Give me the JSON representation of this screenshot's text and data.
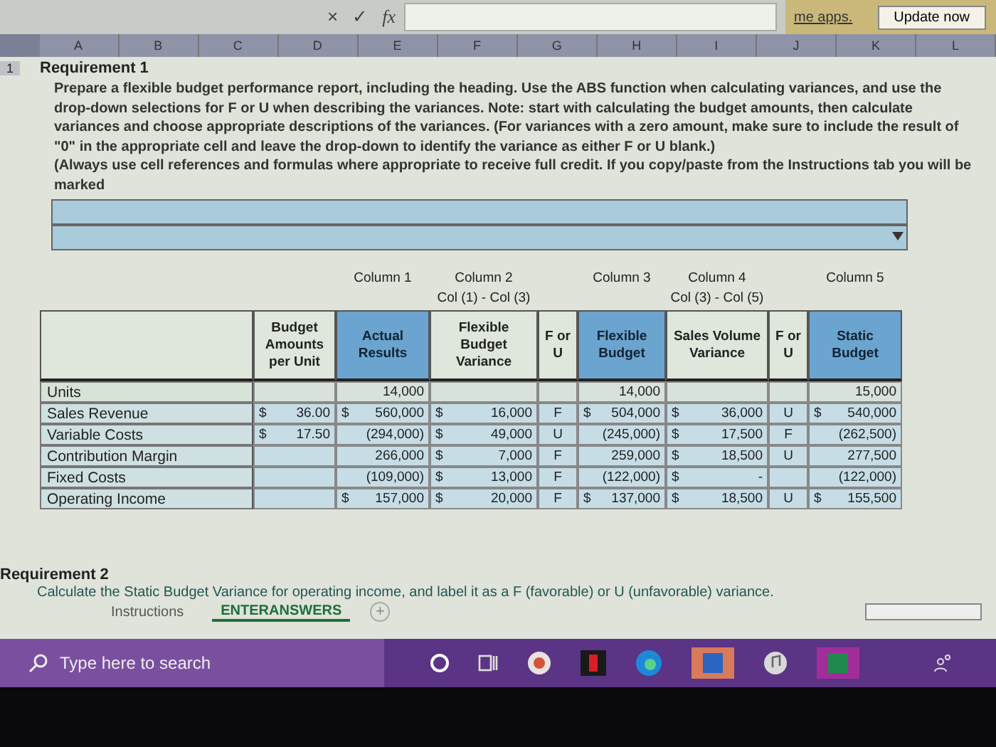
{
  "formula_bar": {
    "cancel": "×",
    "enter": "✓",
    "function": "fx"
  },
  "notice": {
    "text": "me apps.",
    "button": "Update now"
  },
  "column_headers": [
    "A",
    "B",
    "C",
    "D",
    "E",
    "F",
    "G",
    "H",
    "I",
    "J",
    "K",
    "L"
  ],
  "requirement_1": {
    "row_number": "1",
    "title": "Requirement 1",
    "instructions": [
      "Prepare a flexible budget performance report, including the heading. Use the ABS function when calculating variances, and use the drop-down selections for F or U when describing the variances. Note: start with calculating the budget amounts, then calculate variances and choose appropriate descriptions of the variances. (For variances with a zero amount, make sure to include the result of \"0\" in the appropriate cell and leave the drop-down to identify the variance as either F or U blank.)",
      "(Always use cell references and formulas where appropriate to receive full credit. If you copy/paste from the Instructions tab you will be marked"
    ]
  },
  "report": {
    "columns": [
      {
        "label": "Budget Amounts per Unit",
        "highlighted": false
      },
      {
        "group": {
          "title": "Column 1"
        },
        "label": "Actual Results",
        "highlighted": true
      },
      {
        "group": {
          "title": "Column 2",
          "subtitle": "Col (1) - Col (3)"
        },
        "label": "Flexible Budget Variance",
        "highlighted": false
      },
      {
        "label": "F or U",
        "highlighted": false
      },
      {
        "group": {
          "title": "Column 3"
        },
        "label": "Flexible Budget",
        "highlighted": true
      },
      {
        "group": {
          "title": "Column 4",
          "subtitle": "Col (3) - Col (5)"
        },
        "label": "Sales Volume Variance",
        "highlighted": false
      },
      {
        "label": "F or U",
        "highlighted": false
      },
      {
        "group": {
          "title": "Column 5"
        },
        "label": "Static Budget",
        "highlighted": true
      }
    ],
    "rows": [
      {
        "label": "Units",
        "cells": [
          {},
          {
            "value": "14,000"
          },
          {},
          {},
          {
            "value": "14,000"
          },
          {},
          {},
          {
            "value": "15,000"
          }
        ]
      },
      {
        "label": "Sales Revenue",
        "cells": [
          {
            "sign": "$",
            "value": "36.00"
          },
          {
            "sign": "$",
            "value": "560,000"
          },
          {
            "sign": "$",
            "value": "16,000"
          },
          {
            "value": "F"
          },
          {
            "sign": "$",
            "value": "504,000"
          },
          {
            "sign": "$",
            "value": "36,000"
          },
          {
            "value": "U"
          },
          {
            "sign": "$",
            "value": "540,000"
          }
        ]
      },
      {
        "label": "Variable Costs",
        "cells": [
          {
            "sign": "$",
            "value": "17.50"
          },
          {
            "value": "(294,000)"
          },
          {
            "sign": "$",
            "value": "49,000"
          },
          {
            "value": "U"
          },
          {
            "value": "(245,000)"
          },
          {
            "sign": "$",
            "value": "17,500"
          },
          {
            "value": "F"
          },
          {
            "value": "(262,500)"
          }
        ]
      },
      {
        "label": "Contribution Margin",
        "cells": [
          {},
          {
            "value": "266,000"
          },
          {
            "sign": "$",
            "value": "7,000"
          },
          {
            "value": "F"
          },
          {
            "value": "259,000"
          },
          {
            "sign": "$",
            "value": "18,500"
          },
          {
            "value": "U"
          },
          {
            "value": "277,500"
          }
        ]
      },
      {
        "label": "Fixed Costs",
        "cells": [
          {},
          {
            "value": "(109,000)"
          },
          {
            "sign": "$",
            "value": "13,000"
          },
          {
            "value": "F"
          },
          {
            "value": "(122,000)"
          },
          {
            "sign": "$",
            "value": "-"
          },
          {},
          {
            "value": "(122,000)"
          }
        ]
      },
      {
        "label": "Operating Income",
        "cells": [
          {},
          {
            "sign": "$",
            "value": "157,000"
          },
          {
            "sign": "$",
            "value": "20,000"
          },
          {
            "value": "F"
          },
          {
            "sign": "$",
            "value": "137,000"
          },
          {
            "sign": "$",
            "value": "18,500"
          },
          {
            "value": "U"
          },
          {
            "sign": "$",
            "value": "155,500"
          }
        ]
      }
    ]
  },
  "requirement_2": {
    "title": "Requirement 2",
    "text": "Calculate the Static Budget Variance for operating income, and label it as a F (favorable) or U (unfavorable) variance."
  },
  "sheet_tabs": [
    {
      "label": "Instructions",
      "selected": false
    },
    {
      "label": "ENTERANSWERS",
      "selected": true
    }
  ],
  "add_sheet": "+",
  "taskbar": {
    "search_placeholder": "Type here to search"
  }
}
